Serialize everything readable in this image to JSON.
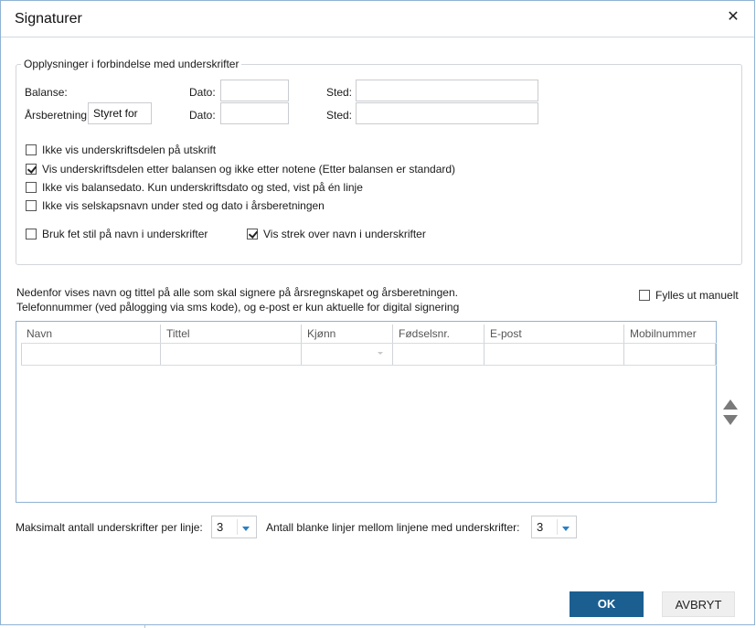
{
  "dialog": {
    "title": "Signaturer",
    "close_glyph": "✕"
  },
  "group": {
    "legend": "Opplysninger i forbindelse med underskrifter",
    "balanse_label": "Balanse:",
    "arsberetning_label": "Årsberetning:",
    "arsberetning_value": "Styret for",
    "dato_label": "Dato:",
    "sted_label": "Sted:",
    "balanse_dato_value": "",
    "balanse_sted_value": "",
    "arsberetning_dato_value": "",
    "arsberetning_sted_value": ""
  },
  "options": [
    {
      "label": "Ikke vis underskriftsdelen på utskrift",
      "checked": false
    },
    {
      "label": "Vis underskriftsdelen etter balansen og ikke etter notene (Etter balansen er standard)",
      "checked": true
    },
    {
      "label": "Ikke vis balansedato. Kun underskriftsdato og sted, vist på én linje",
      "checked": false
    },
    {
      "label": "Ikke vis selskapsnavn under sted og dato i årsberetningen",
      "checked": false
    }
  ],
  "style_options": [
    {
      "label": "Bruk fet stil på navn i underskrifter",
      "checked": false
    },
    {
      "label": "Vis strek over navn i underskrifter",
      "checked": true
    }
  ],
  "info": {
    "line1": "Nedenfor vises navn og tittel på alle som skal signere på årsregnskapet og årsberetningen.",
    "line2": "Telefonnummer (ved pålogging via sms kode), og e-post er kun aktuelle for digital signering"
  },
  "manual": {
    "label": "Fylles ut manuelt",
    "checked": false
  },
  "grid": {
    "columns": [
      "Navn",
      "Tittel",
      "Kjønn",
      "Fødselsnr.",
      "E-post",
      "Mobilnummer"
    ]
  },
  "footer": {
    "max_label": "Maksimalt antall underskrifter per linje:",
    "max_value": "3",
    "blank_label": "Antall blanke linjer mellom linjene med underskrifter:",
    "blank_value": "3"
  },
  "buttons": {
    "ok": "OK",
    "cancel": "AVBRYT"
  },
  "colors": {
    "primary": "#1b5f91",
    "border_accent": "#8fb3d4",
    "caret": "#2a7fc1"
  }
}
